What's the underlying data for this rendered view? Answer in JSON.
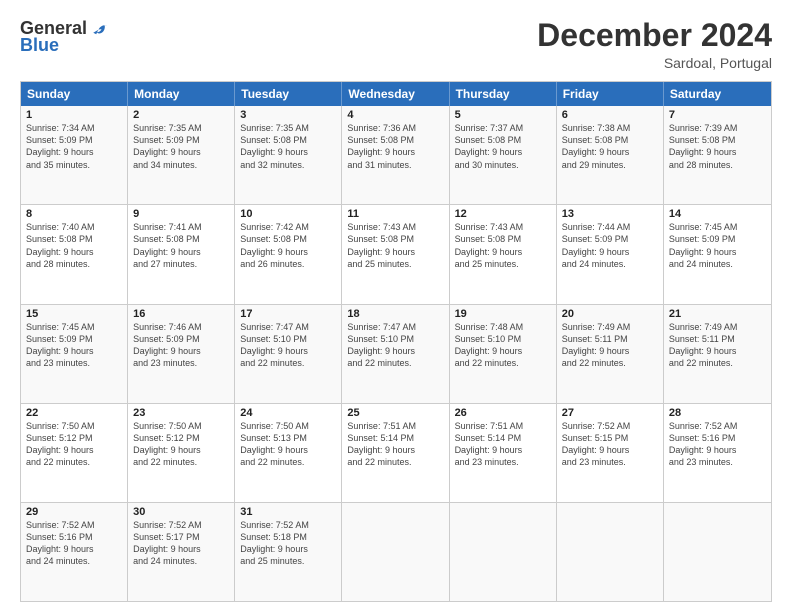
{
  "logo": {
    "general": "General",
    "blue": "Blue"
  },
  "header": {
    "title": "December 2024",
    "location": "Sardoal, Portugal"
  },
  "calendar": {
    "days_of_week": [
      "Sunday",
      "Monday",
      "Tuesday",
      "Wednesday",
      "Thursday",
      "Friday",
      "Saturday"
    ],
    "rows": [
      [
        {
          "day": "1",
          "info": "Sunrise: 7:34 AM\nSunset: 5:09 PM\nDaylight: 9 hours\nand 35 minutes."
        },
        {
          "day": "2",
          "info": "Sunrise: 7:35 AM\nSunset: 5:09 PM\nDaylight: 9 hours\nand 34 minutes."
        },
        {
          "day": "3",
          "info": "Sunrise: 7:35 AM\nSunset: 5:08 PM\nDaylight: 9 hours\nand 32 minutes."
        },
        {
          "day": "4",
          "info": "Sunrise: 7:36 AM\nSunset: 5:08 PM\nDaylight: 9 hours\nand 31 minutes."
        },
        {
          "day": "5",
          "info": "Sunrise: 7:37 AM\nSunset: 5:08 PM\nDaylight: 9 hours\nand 30 minutes."
        },
        {
          "day": "6",
          "info": "Sunrise: 7:38 AM\nSunset: 5:08 PM\nDaylight: 9 hours\nand 29 minutes."
        },
        {
          "day": "7",
          "info": "Sunrise: 7:39 AM\nSunset: 5:08 PM\nDaylight: 9 hours\nand 28 minutes."
        }
      ],
      [
        {
          "day": "8",
          "info": "Sunrise: 7:40 AM\nSunset: 5:08 PM\nDaylight: 9 hours\nand 28 minutes."
        },
        {
          "day": "9",
          "info": "Sunrise: 7:41 AM\nSunset: 5:08 PM\nDaylight: 9 hours\nand 27 minutes."
        },
        {
          "day": "10",
          "info": "Sunrise: 7:42 AM\nSunset: 5:08 PM\nDaylight: 9 hours\nand 26 minutes."
        },
        {
          "day": "11",
          "info": "Sunrise: 7:43 AM\nSunset: 5:08 PM\nDaylight: 9 hours\nand 25 minutes."
        },
        {
          "day": "12",
          "info": "Sunrise: 7:43 AM\nSunset: 5:08 PM\nDaylight: 9 hours\nand 25 minutes."
        },
        {
          "day": "13",
          "info": "Sunrise: 7:44 AM\nSunset: 5:09 PM\nDaylight: 9 hours\nand 24 minutes."
        },
        {
          "day": "14",
          "info": "Sunrise: 7:45 AM\nSunset: 5:09 PM\nDaylight: 9 hours\nand 24 minutes."
        }
      ],
      [
        {
          "day": "15",
          "info": "Sunrise: 7:45 AM\nSunset: 5:09 PM\nDaylight: 9 hours\nand 23 minutes."
        },
        {
          "day": "16",
          "info": "Sunrise: 7:46 AM\nSunset: 5:09 PM\nDaylight: 9 hours\nand 23 minutes."
        },
        {
          "day": "17",
          "info": "Sunrise: 7:47 AM\nSunset: 5:10 PM\nDaylight: 9 hours\nand 22 minutes."
        },
        {
          "day": "18",
          "info": "Sunrise: 7:47 AM\nSunset: 5:10 PM\nDaylight: 9 hours\nand 22 minutes."
        },
        {
          "day": "19",
          "info": "Sunrise: 7:48 AM\nSunset: 5:10 PM\nDaylight: 9 hours\nand 22 minutes."
        },
        {
          "day": "20",
          "info": "Sunrise: 7:49 AM\nSunset: 5:11 PM\nDaylight: 9 hours\nand 22 minutes."
        },
        {
          "day": "21",
          "info": "Sunrise: 7:49 AM\nSunset: 5:11 PM\nDaylight: 9 hours\nand 22 minutes."
        }
      ],
      [
        {
          "day": "22",
          "info": "Sunrise: 7:50 AM\nSunset: 5:12 PM\nDaylight: 9 hours\nand 22 minutes."
        },
        {
          "day": "23",
          "info": "Sunrise: 7:50 AM\nSunset: 5:12 PM\nDaylight: 9 hours\nand 22 minutes."
        },
        {
          "day": "24",
          "info": "Sunrise: 7:50 AM\nSunset: 5:13 PM\nDaylight: 9 hours\nand 22 minutes."
        },
        {
          "day": "25",
          "info": "Sunrise: 7:51 AM\nSunset: 5:14 PM\nDaylight: 9 hours\nand 22 minutes."
        },
        {
          "day": "26",
          "info": "Sunrise: 7:51 AM\nSunset: 5:14 PM\nDaylight: 9 hours\nand 23 minutes."
        },
        {
          "day": "27",
          "info": "Sunrise: 7:52 AM\nSunset: 5:15 PM\nDaylight: 9 hours\nand 23 minutes."
        },
        {
          "day": "28",
          "info": "Sunrise: 7:52 AM\nSunset: 5:16 PM\nDaylight: 9 hours\nand 23 minutes."
        }
      ],
      [
        {
          "day": "29",
          "info": "Sunrise: 7:52 AM\nSunset: 5:16 PM\nDaylight: 9 hours\nand 24 minutes."
        },
        {
          "day": "30",
          "info": "Sunrise: 7:52 AM\nSunset: 5:17 PM\nDaylight: 9 hours\nand 24 minutes."
        },
        {
          "day": "31",
          "info": "Sunrise: 7:52 AM\nSunset: 5:18 PM\nDaylight: 9 hours\nand 25 minutes."
        },
        {
          "day": "",
          "info": ""
        },
        {
          "day": "",
          "info": ""
        },
        {
          "day": "",
          "info": ""
        },
        {
          "day": "",
          "info": ""
        }
      ]
    ]
  }
}
